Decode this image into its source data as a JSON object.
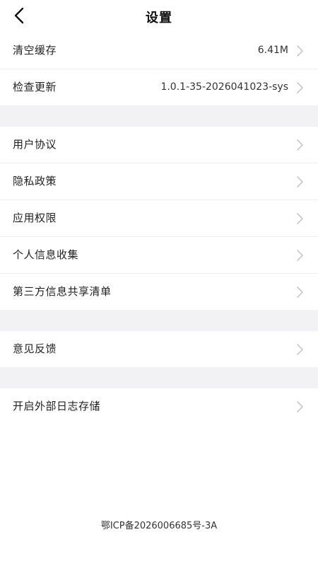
{
  "header": {
    "title": "设置",
    "back_icon": "chevron-left-icon"
  },
  "settings": {
    "group1": [
      {
        "label": "清空缓存",
        "value": "6.41M"
      },
      {
        "label": "检查更新",
        "value": "1.0.1-35-2026041023-sys"
      }
    ],
    "group2": [
      {
        "label": "用户协议"
      },
      {
        "label": "隐私政策"
      },
      {
        "label": "应用权限"
      },
      {
        "label": "个人信息收集"
      },
      {
        "label": "第三方信息共享清单"
      }
    ],
    "group3": [
      {
        "label": "意见反馈"
      }
    ],
    "group4": [
      {
        "label": "开启外部日志存储"
      }
    ]
  },
  "footer": {
    "icp": "鄂ICP备2026006685号-3A"
  },
  "colors": {
    "separator": "#f2f2f4",
    "chevron": "#c8c8cc"
  }
}
